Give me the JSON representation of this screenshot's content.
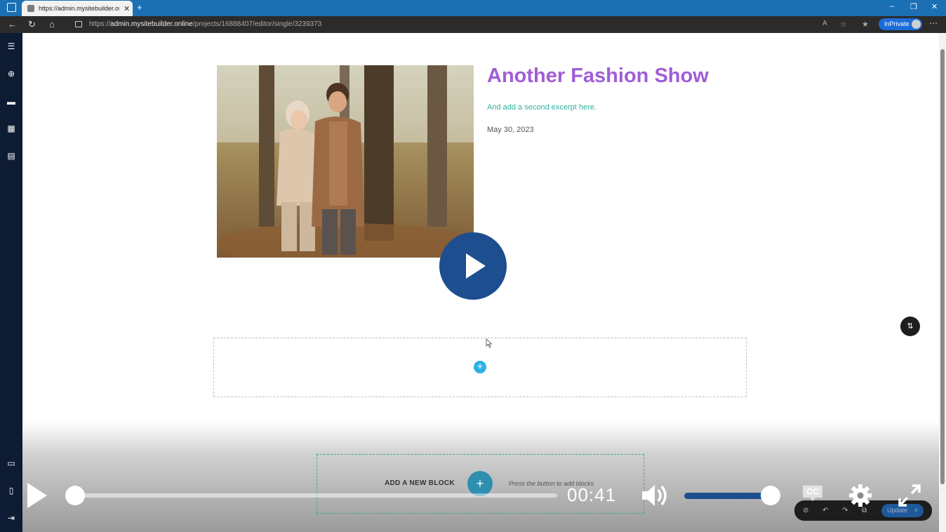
{
  "browser": {
    "tab_title": "https://admin.mysitebuilder.onli",
    "tab_close": "✕",
    "new_tab": "+",
    "url_prefix": "https://",
    "url_domain": "admin.mysitebuilder.online",
    "url_path": "/projects/16888407/editor/single/3239373",
    "inprivate_label": "InPrivate",
    "window_controls": [
      "–",
      "❐",
      "✕"
    ]
  },
  "sidebar": {
    "top_icons": [
      "menu-icon",
      "add-icon",
      "pages-icon",
      "design-icon",
      "comments-icon"
    ],
    "bottom_icons": [
      "desktop-icon",
      "mobile-icon",
      "exit-icon"
    ]
  },
  "post": {
    "title": "Another Fashion Show",
    "excerpt": "And add a second excerpt here.",
    "date": "May 30, 2023"
  },
  "add_block": {
    "label": "ADD A NEW BLOCK",
    "button": "+",
    "hint": "Press the button to add blocks"
  },
  "save_bar": {
    "update_label": "Update"
  },
  "video": {
    "time": "00:41",
    "progress": 0.0,
    "volume": 1.0,
    "cc_label": "CC"
  },
  "colors": {
    "title": "#a05ed6",
    "excerpt": "#2fb39f",
    "player_accent": "#1d4e8f",
    "sidebar": "#0d1b33",
    "tabbar": "#1b6fb3"
  }
}
